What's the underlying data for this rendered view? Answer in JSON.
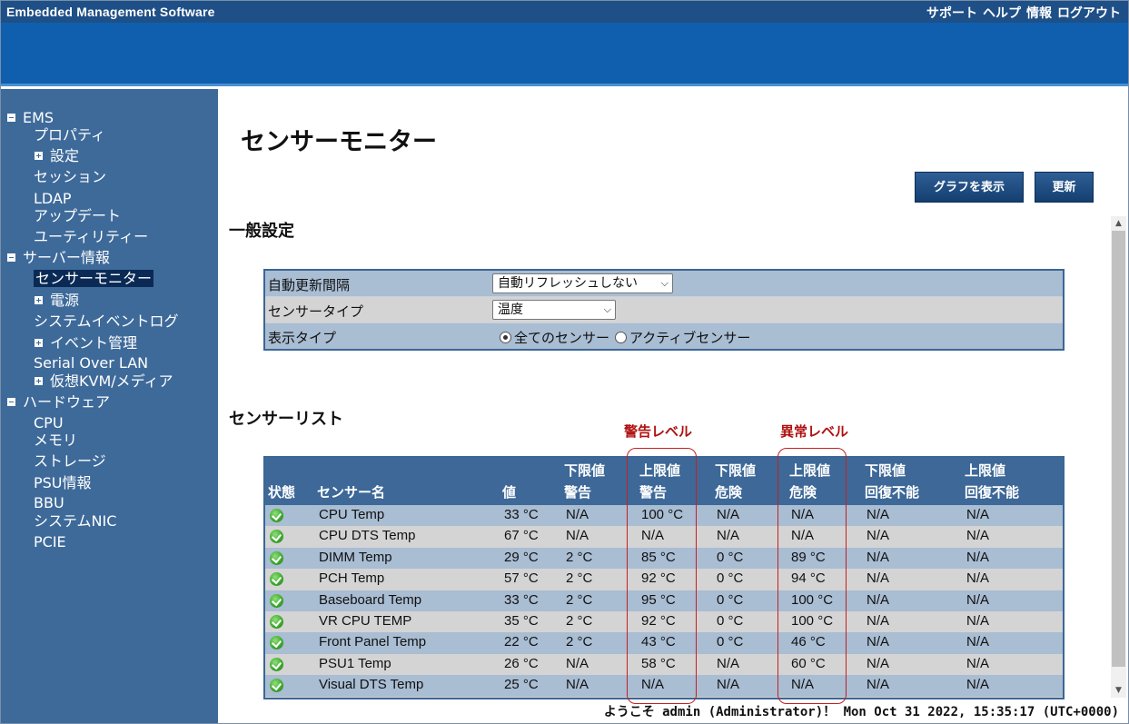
{
  "header": {
    "title": "Embedded Management Software",
    "links": [
      "サポート",
      "ヘルプ",
      "情報",
      "ログアウト"
    ]
  },
  "sidebar": {
    "items": [
      {
        "label": "EMS",
        "icon": "minus"
      },
      {
        "label": "プロパティ"
      },
      {
        "label": "設定",
        "icon": "plus"
      },
      {
        "label": "セッション"
      },
      {
        "label": "LDAP"
      },
      {
        "label": "アップデート"
      },
      {
        "label": "ユーティリティー"
      },
      {
        "label": "サーバー情報",
        "icon": "minus"
      },
      {
        "label": "センサーモニター",
        "active": true
      },
      {
        "label": "電源",
        "icon": "plus"
      },
      {
        "label": "システムイベントログ"
      },
      {
        "label": "イベント管理",
        "icon": "plus"
      },
      {
        "label": "Serial Over LAN"
      },
      {
        "label": "仮想KVM/メディア",
        "icon": "plus"
      },
      {
        "label": "ハードウェア",
        "icon": "minus"
      },
      {
        "label": "CPU"
      },
      {
        "label": "メモリ"
      },
      {
        "label": "ストレージ"
      },
      {
        "label": "PSU情報"
      },
      {
        "label": "BBU"
      },
      {
        "label": "システムNIC"
      },
      {
        "label": "PCIE"
      }
    ]
  },
  "main": {
    "page_title": "センサーモニター",
    "buttons": {
      "graph": "グラフを表示",
      "refresh": "更新"
    },
    "general_title": "一般設定",
    "settings": {
      "refresh_label": "自動更新間隔",
      "refresh_value": "自動リフレッシュしない",
      "sensor_type_label": "センサータイプ",
      "sensor_type_value": "温度",
      "display_type_label": "表示タイプ",
      "display_options": [
        "全てのセンサー",
        "アクティブセンサー"
      ],
      "display_selected": 0
    },
    "list_title": "センサーリスト",
    "warning_level": "警告レベル",
    "critical_level": "異常レベル",
    "columns": [
      [
        "",
        "状態"
      ],
      [
        "",
        "センサー名"
      ],
      [
        "",
        "値"
      ],
      [
        "下限値",
        "警告"
      ],
      [
        "上限値",
        "警告"
      ],
      [
        "下限値",
        "危険"
      ],
      [
        "上限値",
        "危険"
      ],
      [
        "下限値",
        "回復不能"
      ],
      [
        "上限値",
        "回復不能"
      ]
    ],
    "rows": [
      [
        "CPU Temp",
        "33 °C",
        "N/A",
        "100 °C",
        "N/A",
        "N/A",
        "N/A",
        "N/A"
      ],
      [
        "CPU DTS Temp",
        "67 °C",
        "N/A",
        "N/A",
        "N/A",
        "N/A",
        "N/A",
        "N/A"
      ],
      [
        "DIMM Temp",
        "29 °C",
        "2 °C",
        "85 °C",
        "0 °C",
        "89 °C",
        "N/A",
        "N/A"
      ],
      [
        "PCH Temp",
        "57 °C",
        "2 °C",
        "92 °C",
        "0 °C",
        "94 °C",
        "N/A",
        "N/A"
      ],
      [
        "Baseboard Temp",
        "33 °C",
        "2 °C",
        "95 °C",
        "0 °C",
        "100 °C",
        "N/A",
        "N/A"
      ],
      [
        "VR CPU TEMP",
        "35 °C",
        "2 °C",
        "92 °C",
        "0 °C",
        "100 °C",
        "N/A",
        "N/A"
      ],
      [
        "Front Panel Temp",
        "22 °C",
        "2 °C",
        "43 °C",
        "0 °C",
        "46 °C",
        "N/A",
        "N/A"
      ],
      [
        "PSU1 Temp",
        "26 °C",
        "N/A",
        "58 °C",
        "N/A",
        "60 °C",
        "N/A",
        "N/A"
      ],
      [
        "Visual DTS Temp",
        "25 °C",
        "N/A",
        "N/A",
        "N/A",
        "N/A",
        "N/A",
        "N/A"
      ]
    ],
    "status_icon": "check-circle-icon"
  },
  "footer": {
    "status": "ようこそ admin (Administrator)！ Mon Oct 31 2022, 15:35:17 (UTC+0000)"
  },
  "colors": {
    "topbar": "#1f4f87",
    "banner": "#0f5fae",
    "sidebar": "#3e6a9a",
    "table_header": "#3d6898",
    "row_odd": "#a9bdd3",
    "row_even": "#d4d4d4",
    "highlight": "#c62020"
  }
}
